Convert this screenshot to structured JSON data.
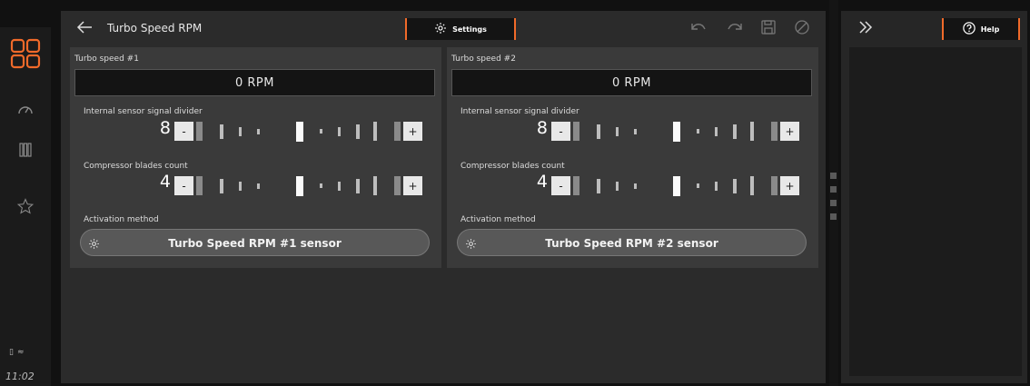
{
  "header": {
    "title": "Turbo Speed RPM",
    "settings_label": "Settings",
    "help_label": "Help"
  },
  "status": {
    "time": "11:02"
  },
  "colors": {
    "accent": "#f06a2a",
    "background": "#2b2b2b",
    "card": "#3a3a3a"
  },
  "icons": [
    "back-arrow-icon",
    "gear-icon",
    "undo-icon",
    "redo-icon",
    "save-icon",
    "cancel-icon",
    "expand-icon",
    "help-icon",
    "apps-icon",
    "gauge-icon",
    "columns-icon",
    "star-icon",
    "battery-icon",
    "wifi-icon"
  ],
  "cards": [
    {
      "title": "Turbo speed #1",
      "rpm": "0 RPM",
      "divider": {
        "label": "Internal sensor signal divider",
        "value": "8",
        "minus": "-",
        "plus": "+"
      },
      "blades": {
        "label": "Compressor blades count",
        "value": "4",
        "minus": "-",
        "plus": "+"
      },
      "activation": {
        "label": "Activation method",
        "button": "Turbo Speed RPM #1 sensor"
      }
    },
    {
      "title": "Turbo speed #2",
      "rpm": "0 RPM",
      "divider": {
        "label": "Internal sensor signal divider",
        "value": "8",
        "minus": "-",
        "plus": "+"
      },
      "blades": {
        "label": "Compressor blades count",
        "value": "4",
        "minus": "-",
        "plus": "+"
      },
      "activation": {
        "label": "Activation method",
        "button": "Turbo Speed RPM #2 sensor"
      }
    }
  ]
}
